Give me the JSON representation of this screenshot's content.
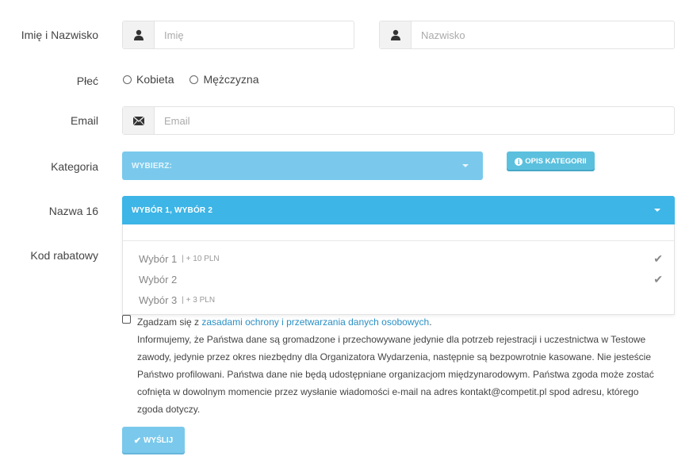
{
  "labels": {
    "name": "Imię i Nazwisko",
    "gender": "Płeć",
    "email": "Email",
    "category": "Kategoria",
    "name16": "Nazwa 16",
    "discount": "Kod rabatowy"
  },
  "fields": {
    "first_name_placeholder": "Imię",
    "last_name_placeholder": "Nazwisko",
    "email_placeholder": "Email"
  },
  "gender": {
    "options": [
      "Kobieta",
      "Mężczyzna"
    ]
  },
  "category": {
    "selected": "WYBIERZ:",
    "info_button": "OPIS KATEGORII"
  },
  "name16": {
    "selected": "WYBÓR 1, WYBÓR 2",
    "options": [
      {
        "label": "Wybór 1",
        "price": "| + 10 PLN",
        "checked": true
      },
      {
        "label": "Wybór 2",
        "price": "",
        "checked": true
      },
      {
        "label": "Wybór 3",
        "price": "| + 3 PLN",
        "checked": false
      }
    ]
  },
  "consent": {
    "prefix": "Zgadzam się z ",
    "link": "zasadami ochrony i przetwarzania danych osobowych",
    "suffix": ".",
    "body_lines": [
      "Informujemy, że Państwa dane są gromadzone i przechowywane jedynie dla potrzeb rejestracji i uczestnictwa w Testowe",
      "zawody, jedynie przez okres niezbędny dla Organizatora Wydarzenia, następnie są bezpowrotnie kasowane. Nie jesteście",
      "Państwo profilowani. Państwa dane nie będą udostępniane organizacjom międzynarodowym. Państwa zgoda może zostać",
      "cofnięta w dowolnym momencie przez wysłanie wiadomości e-mail na adres kontakt@competit.pl spod adresu, którego",
      "zgoda dotyczy."
    ]
  },
  "submit": {
    "label": "WYŚLIJ"
  },
  "icons": {
    "user": "user-icon",
    "email": "envelope-icon",
    "check": "check-icon",
    "info": "info-icon"
  }
}
